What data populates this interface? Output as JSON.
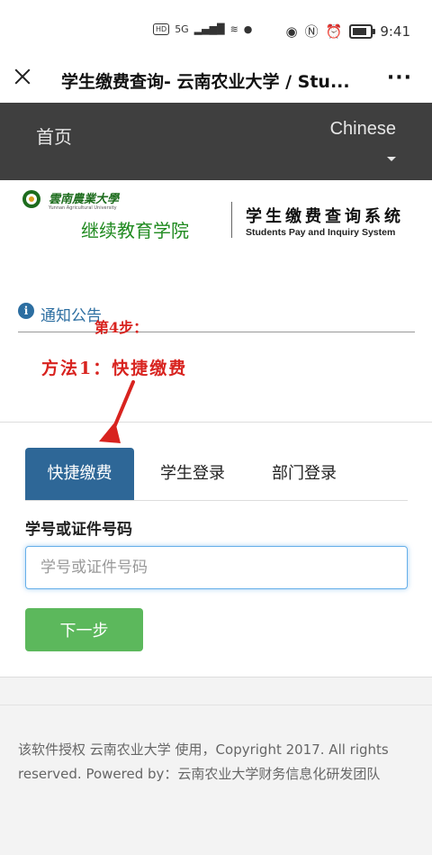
{
  "status_bar": {
    "network": "HD",
    "signal": "5G",
    "time": "9:41"
  },
  "title_bar": {
    "title": "学生缴费查询- 云南农业大学 / Stu...",
    "more_label": "···"
  },
  "nav": {
    "home": "首页",
    "language": "Chinese"
  },
  "header": {
    "school_name": "雲南農業大學",
    "school_name_en": "Yunnan Agricultural University",
    "college": "继续教育学院",
    "system_title": "学生缴费查询系统",
    "system_subtitle": "Students Pay and Inquiry System"
  },
  "notice": {
    "icon": "info-circle-icon",
    "label": "通知公告"
  },
  "annotation": {
    "step": "第4步：",
    "method": "方法1：快捷缴费",
    "color": "#d8231f"
  },
  "tabs": [
    {
      "label": "快捷缴费",
      "active": true
    },
    {
      "label": "学生登录",
      "active": false
    },
    {
      "label": "部门登录",
      "active": false
    }
  ],
  "form": {
    "field_label": "学号或证件号码",
    "placeholder": "学号或证件号码",
    "value": "",
    "next_label": "下一步"
  },
  "footer": {
    "text": "该软件授权 云南农业大学 使用，Copyright 2017. All rights reserved. Powered by：云南农业大学财务信息化研发团队"
  },
  "colors": {
    "navbar": "#3f3f3f",
    "tab_active": "#2e6797",
    "button": "#5cb85c",
    "notice": "#2c6ea1"
  }
}
